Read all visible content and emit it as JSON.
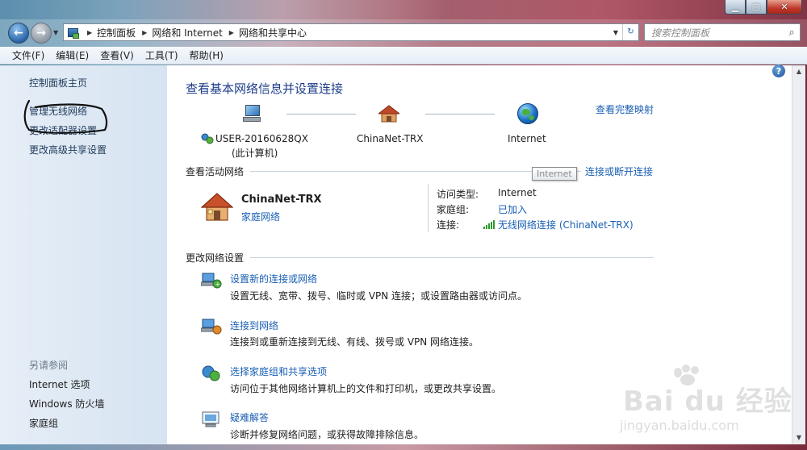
{
  "address": {
    "crumbs": [
      "控制面板",
      "网络和 Internet",
      "网络和共享中心"
    ],
    "search_placeholder": "搜索控制面板"
  },
  "menu": [
    "文件(F)",
    "编辑(E)",
    "查看(V)",
    "工具(T)",
    "帮助(H)"
  ],
  "sidebar": {
    "home": "控制面板主页",
    "links": [
      "管理无线网络",
      "更改适配器设置",
      "更改高级共享设置"
    ],
    "see_also_title": "另请参阅",
    "see_also": [
      "Internet 选项",
      "Windows 防火墙",
      "家庭组"
    ]
  },
  "main": {
    "title": "查看基本网络信息并设置连接",
    "view_full_map": "查看完整映射",
    "nodes": {
      "computer_name": "USER-20160628QX",
      "computer_sub": "(此计算机)",
      "network": "ChinaNet-TRX",
      "internet": "Internet"
    },
    "active_networks_label": "查看活动网络",
    "connect_disconnect": "连接或断开连接",
    "tooltip": "Internet",
    "active": {
      "name": "ChinaNet-TRX",
      "type": "家庭网络",
      "access_type_key": "访问类型:",
      "access_type_val": "Internet",
      "homegroup_key": "家庭组:",
      "homegroup_val": "已加入",
      "connection_key": "连接:",
      "connection_val": "无线网络连接 (ChinaNet-TRX)"
    },
    "change_settings_label": "更改网络设置",
    "tasks": [
      {
        "link": "设置新的连接或网络",
        "desc": "设置无线、宽带、拨号、临时或 VPN 连接；或设置路由器或访问点。"
      },
      {
        "link": "连接到网络",
        "desc": "连接到或重新连接到无线、有线、拨号或 VPN 网络连接。"
      },
      {
        "link": "选择家庭组和共享选项",
        "desc": "访问位于其他网络计算机上的文件和打印机，或更改共享设置。"
      },
      {
        "link": "疑难解答",
        "desc": "诊断并修复网络问题，或获得故障排除信息。"
      }
    ]
  },
  "watermark": {
    "text": "Bai du 经验",
    "sub": "jingyan.baidu.com"
  }
}
